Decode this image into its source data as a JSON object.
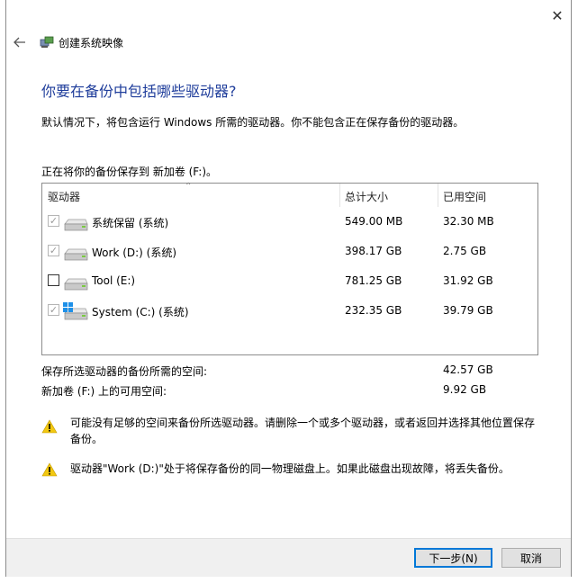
{
  "window": {
    "title": "创建系统映像"
  },
  "heading": "你要在备份中包括哪些驱动器?",
  "description": "默认情况下，将包含运行 Windows 所需的驱动器。你不能包含正在保存备份的驱动器。",
  "saving_to": "正在将你的备份保存到 新加卷 (F:)。",
  "columns": {
    "drive": "驱动器",
    "total": "总计大小",
    "used": "已用空间"
  },
  "drives": [
    {
      "name": "系统保留 (系统)",
      "total": "549.00 MB",
      "used": "32.30 MB",
      "checked": true,
      "disabled": true,
      "icon": "hard-drive-icon"
    },
    {
      "name": "Work (D:) (系统)",
      "total": "398.17 GB",
      "used": "2.75 GB",
      "checked": true,
      "disabled": true,
      "icon": "hard-drive-icon"
    },
    {
      "name": "Tool (E:)",
      "total": "781.25 GB",
      "used": "31.92 GB",
      "checked": false,
      "disabled": false,
      "icon": "hard-drive-icon"
    },
    {
      "name": "System (C:) (系统)",
      "total": "232.35 GB",
      "used": "39.79 GB",
      "checked": true,
      "disabled": true,
      "icon": "windows-drive-icon"
    }
  ],
  "summary": {
    "required_label": "保存所选驱动器的备份所需的空间:",
    "required_value": "42.57 GB",
    "free_label": "新加卷 (F:) 上的可用空间:",
    "free_value": "9.92 GB"
  },
  "warnings": [
    "可能没有足够的空间来备份所选驱动器。请删除一个或多个驱动器，或者返回并选择其他位置保存备份。",
    "驱动器\"Work (D:)\"处于将保存备份的同一物理磁盘上。如果此磁盘出现故障，将丢失备份。"
  ],
  "buttons": {
    "next": "下一步(N)",
    "cancel": "取消"
  },
  "colors": {
    "heading": "#1f3d9b",
    "accent": "#0078d7",
    "warning": "#f2c811"
  }
}
